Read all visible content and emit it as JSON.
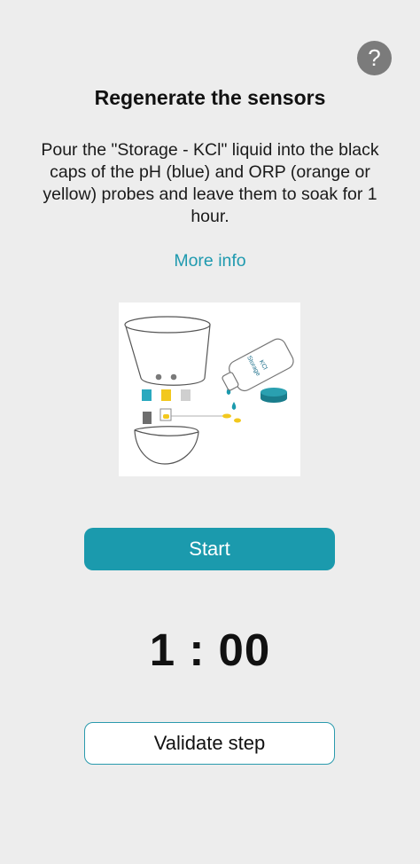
{
  "header": {
    "help_label": "?"
  },
  "main": {
    "title": "Regenerate the sensors",
    "instructions": "Pour the \"Storage - KCl\" liquid into the black caps of the pH (blue) and ORP (orange or yellow) probes and leave them to soak for 1 hour.",
    "more_info": "More info",
    "illustration": {
      "bottle_label_line1": "Storage",
      "bottle_label_line2": "KCl"
    },
    "start_label": "Start",
    "timer": "1 : 00",
    "validate_label": "Validate step"
  },
  "colors": {
    "background": "#ededed",
    "accent": "#1b9aad",
    "link": "#1f9aaf",
    "help_bg": "#7b7b7b",
    "ph_blue": "#2aa9bf",
    "orp_yellow": "#f2c81e"
  },
  "icons": {
    "help": "question-mark-icon"
  }
}
